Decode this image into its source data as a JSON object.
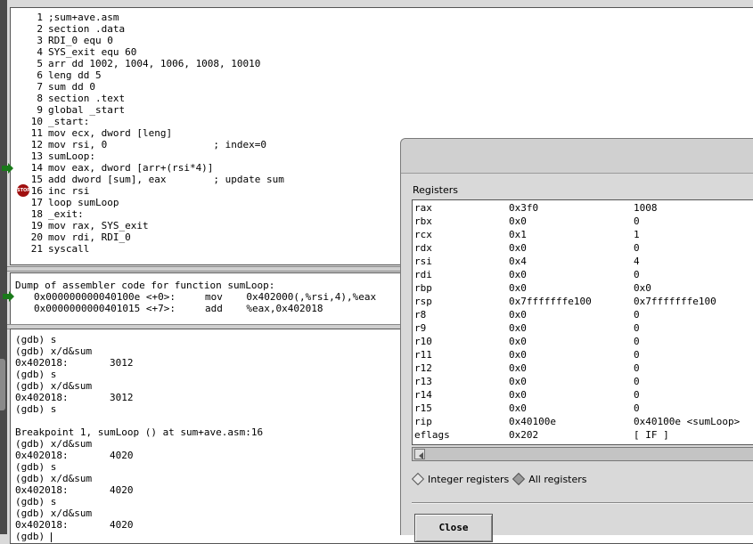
{
  "source": {
    "lines": [
      {
        "num": "1",
        "text": ";sum+ave.asm"
      },
      {
        "num": "2",
        "text": "section .data"
      },
      {
        "num": "3",
        "text": "RDI_0 equ 0"
      },
      {
        "num": "4",
        "text": "SYS_exit equ 60"
      },
      {
        "num": "5",
        "text": "arr dd 1002, 1004, 1006, 1008, 10010"
      },
      {
        "num": "6",
        "text": "leng dd 5"
      },
      {
        "num": "7",
        "text": "sum dd 0"
      },
      {
        "num": "8",
        "text": "section .text"
      },
      {
        "num": "9",
        "text": "global _start"
      },
      {
        "num": "10",
        "text": "_start:"
      },
      {
        "num": "11",
        "text": "mov ecx, dword [leng]"
      },
      {
        "num": "12",
        "text": "mov rsi, 0                  ; index=0"
      },
      {
        "num": "13",
        "text": "sumLoop:"
      },
      {
        "num": "14",
        "text": "mov eax, dword [arr+(rsi*4)]"
      },
      {
        "num": "15",
        "text": "add dword [sum], eax        ; update sum"
      },
      {
        "num": "16",
        "text": "inc rsi"
      },
      {
        "num": "17",
        "text": "loop sumLoop"
      },
      {
        "num": "18",
        "text": "_exit:"
      },
      {
        "num": "19",
        "text": "mov rax, SYS_exit"
      },
      {
        "num": "20",
        "text": "mov rdi, RDI_0"
      },
      {
        "num": "21",
        "text": "syscall"
      }
    ],
    "breakpoint_label": "STOP"
  },
  "disassembly": {
    "header": "Dump of assembler code for function sumLoop:",
    "lines": [
      "0x000000000040100e <+0>:     mov    0x402000(,%rsi,4),%eax",
      "0x0000000000401015 <+7>:     add    %eax,0x402018"
    ]
  },
  "console": {
    "lines": [
      "(gdb) s",
      "(gdb) x/d&sum",
      "0x402018:       3012",
      "(gdb) s",
      "(gdb) x/d&sum",
      "0x402018:       3012",
      "(gdb) s",
      "",
      "Breakpoint 1, sumLoop () at sum+ave.asm:16",
      "(gdb) x/d&sum",
      "0x402018:       4020",
      "(gdb) s",
      "(gdb) x/d&sum",
      "0x402018:       4020",
      "(gdb) s",
      "(gdb) x/d&sum",
      "0x402018:       4020"
    ],
    "prompt": "(gdb) "
  },
  "registers": {
    "title": "Registers",
    "rows": [
      {
        "name": "rax",
        "hex": "0x3f0",
        "value": "1008"
      },
      {
        "name": "rbx",
        "hex": "0x0",
        "value": "0"
      },
      {
        "name": "rcx",
        "hex": "0x1",
        "value": "1"
      },
      {
        "name": "rdx",
        "hex": "0x0",
        "value": "0"
      },
      {
        "name": "rsi",
        "hex": "0x4",
        "value": "4"
      },
      {
        "name": "rdi",
        "hex": "0x0",
        "value": "0"
      },
      {
        "name": "rbp",
        "hex": "0x0",
        "value": "0x0"
      },
      {
        "name": "rsp",
        "hex": "0x7fffffffe100",
        "value": "0x7fffffffe100"
      },
      {
        "name": "r8",
        "hex": "0x0",
        "value": "0"
      },
      {
        "name": "r9",
        "hex": "0x0",
        "value": "0"
      },
      {
        "name": "r10",
        "hex": "0x0",
        "value": "0"
      },
      {
        "name": "r11",
        "hex": "0x0",
        "value": "0"
      },
      {
        "name": "r12",
        "hex": "0x0",
        "value": "0"
      },
      {
        "name": "r13",
        "hex": "0x0",
        "value": "0"
      },
      {
        "name": "r14",
        "hex": "0x0",
        "value": "0"
      },
      {
        "name": "r15",
        "hex": "0x0",
        "value": "0"
      },
      {
        "name": "rip",
        "hex": "0x40100e",
        "value": "0x40100e <sumLoop>"
      },
      {
        "name": "eflags",
        "hex": "0x202",
        "value": "[ IF ]"
      }
    ],
    "radio_options": [
      {
        "label": "Integer registers",
        "checked": false
      },
      {
        "label": "All registers",
        "checked": true
      }
    ],
    "close_label": "Close"
  },
  "colors": {
    "current_line_arrow": "#1a7a1a",
    "breakpoint": "#a01010"
  }
}
